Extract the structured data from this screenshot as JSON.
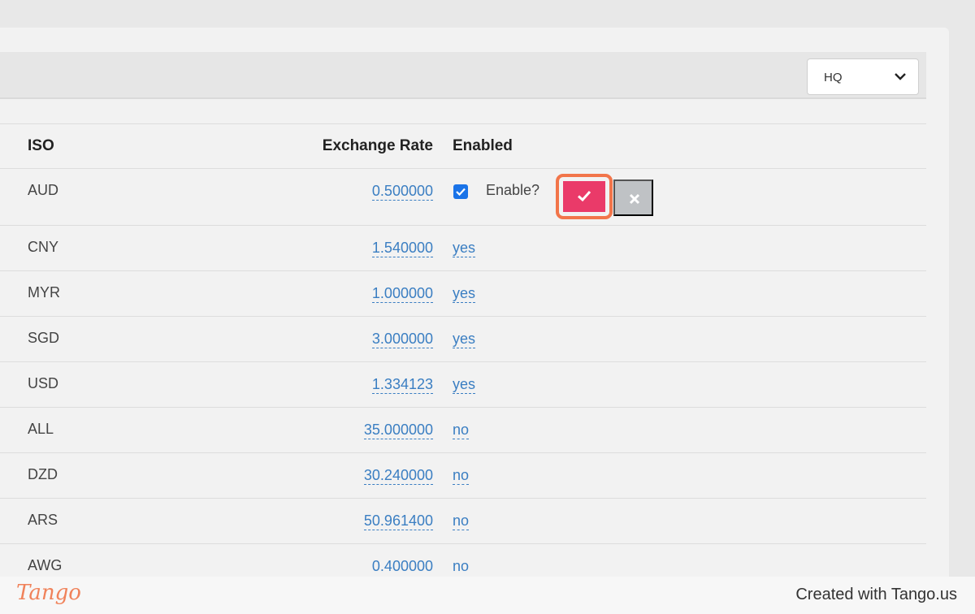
{
  "filter": {
    "selected": "HQ"
  },
  "table": {
    "headers": {
      "iso": "ISO",
      "rate": "Exchange Rate",
      "enabled": "Enabled"
    },
    "rows": [
      {
        "iso": "AUD",
        "rate": "0.500000",
        "enabled": "",
        "editing": true
      },
      {
        "iso": "CNY",
        "rate": "1.540000",
        "enabled": "yes"
      },
      {
        "iso": "MYR",
        "rate": "1.000000",
        "enabled": "yes"
      },
      {
        "iso": "SGD",
        "rate": "3.000000",
        "enabled": "yes"
      },
      {
        "iso": "USD",
        "rate": "1.334123",
        "enabled": "yes"
      },
      {
        "iso": "ALL",
        "rate": "35.000000",
        "enabled": "no"
      },
      {
        "iso": "DZD",
        "rate": "30.240000",
        "enabled": "no"
      },
      {
        "iso": "ARS",
        "rate": "50.961400",
        "enabled": "no"
      },
      {
        "iso": "AWG",
        "rate": "0.400000",
        "enabled": "no"
      }
    ]
  },
  "inline_edit": {
    "label": "Enable?",
    "checked": true
  },
  "footer": {
    "logo": "Tango",
    "credit": "Created with Tango.us"
  },
  "colors": {
    "link": "#3a7ec2",
    "confirm": "#ea3a69",
    "cancel": "#bfc2c5",
    "highlight": "#f2754a",
    "checkbox": "#1a73e8"
  }
}
